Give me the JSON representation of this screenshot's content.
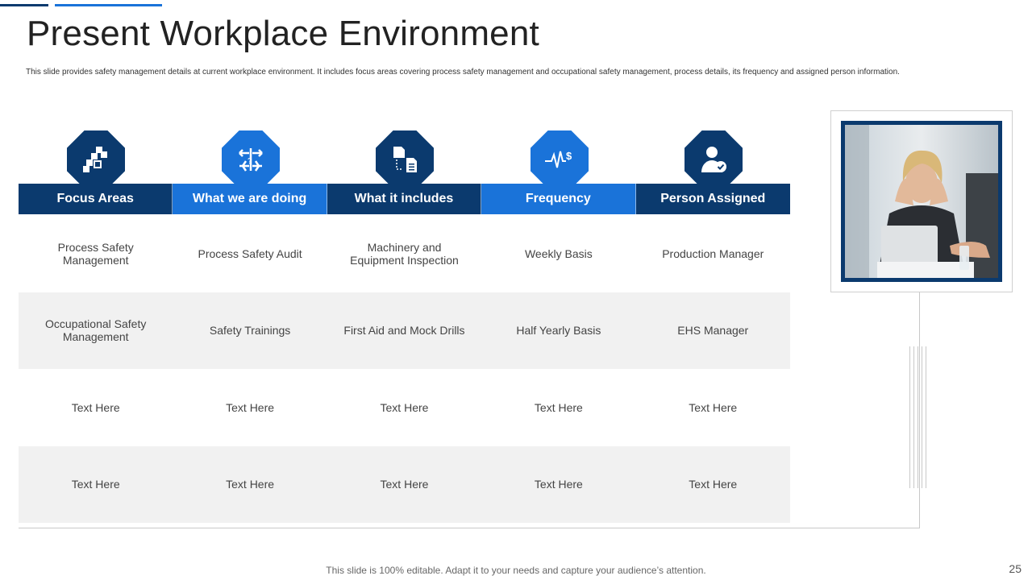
{
  "slide": {
    "title": "Present Workplace Environment",
    "subtitle": "This slide provides safety management details at current workplace environment. It includes focus areas covering process safety management and occupational safety management, process details, its frequency and assigned person information.",
    "footer": "This slide is 100% editable. Adapt it to your needs and capture your audience’s attention.",
    "page_number": "25"
  },
  "colors": {
    "dark_blue": "#0b3a6e",
    "bright_blue": "#1a73d9",
    "row_shade": "#f1f1f1"
  },
  "columns": [
    {
      "header": "Focus Areas",
      "icon": "puzzle-blocks-icon",
      "tone": "dark"
    },
    {
      "header": "What we are doing",
      "icon": "process-arrows-icon",
      "tone": "bright"
    },
    {
      "header": "What it includes",
      "icon": "document-flow-icon",
      "tone": "dark"
    },
    {
      "header": "Frequency",
      "icon": "pulse-dollar-icon",
      "tone": "bright"
    },
    {
      "header": "Person Assigned",
      "icon": "user-check-icon",
      "tone": "dark"
    }
  ],
  "rows": [
    [
      "Process Safety Management",
      "Process Safety Audit",
      "Machinery and Equipment Inspection",
      "Weekly Basis",
      "Production Manager"
    ],
    [
      "Occupational Safety Management",
      "Safety Trainings",
      "First Aid and Mock Drills",
      "Half Yearly Basis",
      "EHS  Manager"
    ],
    [
      "Text Here",
      "Text Here",
      "Text Here",
      "Text Here",
      "Text Here"
    ],
    [
      "Text Here",
      "Text Here",
      "Text Here",
      "Text Here",
      "Text Here"
    ]
  ],
  "photo": {
    "subject": "stressed-woman-at-laptop"
  }
}
